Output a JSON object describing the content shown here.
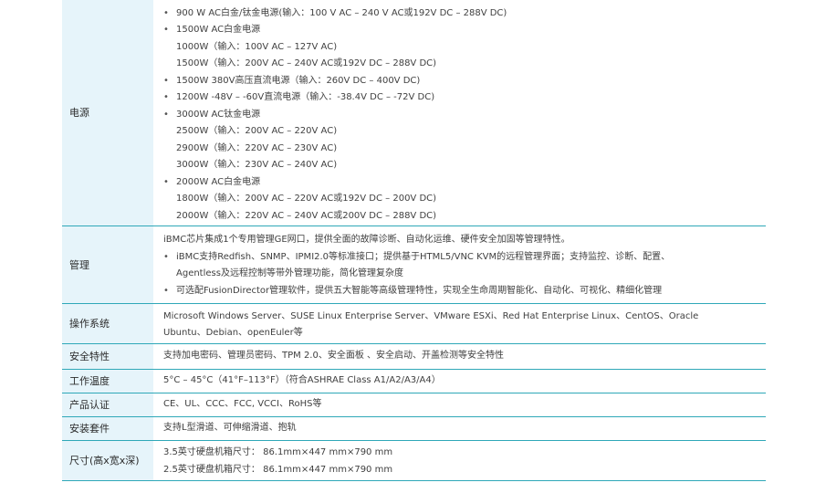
{
  "rows": [
    {
      "label": "电源",
      "lines": [
        {
          "kind": "bullet",
          "text": "900 W AC白金/钛金电源(输入：100 V AC – 240 V AC或192V DC – 288V DC)"
        },
        {
          "kind": "bullet",
          "text": "1500W AC白金电源"
        },
        {
          "kind": "indent",
          "text": "1000W（输入：100V AC – 127V AC)"
        },
        {
          "kind": "indent",
          "text": "1500W（输入：200V AC – 240V AC或192V DC – 288V DC)"
        },
        {
          "kind": "bullet",
          "text": "1500W 380V高压直流电源（输入：260V DC – 400V DC)"
        },
        {
          "kind": "bullet",
          "text": "1200W -48V – -60V直流电源（输入：-38.4V DC – -72V DC)"
        },
        {
          "kind": "bullet",
          "text": "3000W AC钛金电源"
        },
        {
          "kind": "indent",
          "text": "2500W（输入：200V AC – 220V AC)"
        },
        {
          "kind": "indent",
          "text": "2900W（输入：220V AC – 230V AC)"
        },
        {
          "kind": "indent",
          "text": "3000W（输入：230V AC – 240V AC)"
        },
        {
          "kind": "bullet",
          "text": "2000W AC白金电源"
        },
        {
          "kind": "indent",
          "text": "1800W（输入：200V AC – 220V AC或192V DC – 200V DC)"
        },
        {
          "kind": "indent",
          "text": "2000W（输入：220V AC – 240V AC或200V DC – 288V DC)"
        }
      ]
    },
    {
      "label": "管理",
      "lines": [
        {
          "kind": "plain",
          "text": "iBMC芯片集成1个专用管理GE网口，提供全面的故障诊断、自动化运维、硬件安全加固等管理特性。"
        },
        {
          "kind": "bullet",
          "text": "iBMC支持Redfish、SNMP、IPMI2.0等标准接口；提供基于HTML5/VNC KVM的远程管理界面；支持监控、诊断、配置、"
        },
        {
          "kind": "indent",
          "text": "Agentless及远程控制等带外管理功能，简化管理复杂度"
        },
        {
          "kind": "bullet",
          "text": "可选配FusionDirector管理软件，提供五大智能等高级管理特性，实现全生命周期智能化、自动化、可视化、精细化管理"
        }
      ]
    },
    {
      "label": "操作系统",
      "lines": [
        {
          "kind": "plain",
          "text": "Microsoft Windows Server、SUSE Linux Enterprise Server、VMware ESXi、Red Hat Enterprise Linux、CentOS、Oracle"
        },
        {
          "kind": "plain",
          "text": "Ubuntu、Debian、openEuler等"
        }
      ]
    },
    {
      "label": "安全特性",
      "lines": [
        {
          "kind": "plain",
          "text": "支持加电密码、管理员密码、TPM 2.0、安全面板 、安全启动、开盖检测等安全特性"
        }
      ]
    },
    {
      "label": "工作温度",
      "lines": [
        {
          "kind": "plain",
          "text": "5°C – 45°C（41°F–113°F）（符合ASHRAE Class A1/A2/A3/A4）"
        }
      ]
    },
    {
      "label": "产品认证",
      "lines": [
        {
          "kind": "plain",
          "text": "CE、UL、CCC、FCC, VCCI、RoHS等"
        }
      ]
    },
    {
      "label": "安装套件",
      "lines": [
        {
          "kind": "plain",
          "text": "支持L型滑道、可伸缩滑道、抱轨"
        }
      ]
    },
    {
      "label": "尺寸(高x宽x深)",
      "lines": [
        {
          "kind": "plain",
          "text": "3.5英寸硬盘机箱尺寸：  86.1mm×447 mm×790 mm"
        },
        {
          "kind": "plain",
          "text": "2.5英寸硬盘机箱尺寸：  86.1mm×447 mm×790 mm"
        }
      ]
    }
  ]
}
